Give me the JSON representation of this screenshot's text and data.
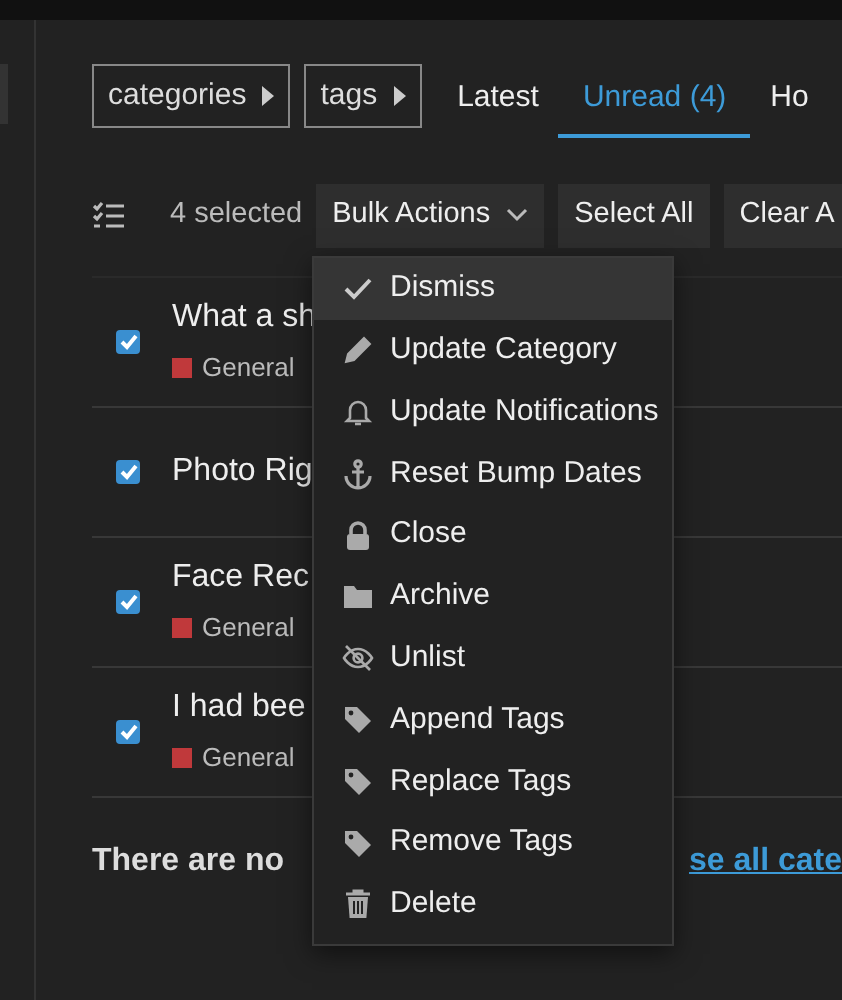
{
  "filters": [
    {
      "label": "categories"
    },
    {
      "label": "tags"
    }
  ],
  "tabs": [
    {
      "label": "Latest",
      "selected": false
    },
    {
      "label": "Unread (4)",
      "selected": true
    },
    {
      "label": "Ho",
      "selected": false
    }
  ],
  "toolbar": {
    "count": "4 selected",
    "buttons": [
      {
        "label": "Bulk Actions",
        "kind": "dropdown"
      },
      {
        "label": "Select All",
        "kind": "plain"
      },
      {
        "label": "Clear A",
        "kind": "plain"
      }
    ]
  },
  "topics": [
    {
      "title": "What a sh",
      "checked": true,
      "category": {
        "name": "General",
        "color": "#c0393b"
      }
    },
    {
      "title": "Photo Rig",
      "checked": true
    },
    {
      "title": "Face Rec",
      "checked": true,
      "category": {
        "name": "General",
        "color": "#c0393b"
      }
    },
    {
      "title": "I had bee",
      "checked": true,
      "category": {
        "name": "General",
        "color": "#c0393b"
      }
    }
  ],
  "footer": {
    "text": "There are no",
    "link": "se all cate"
  },
  "bulk_menu": [
    {
      "label": "Dismiss",
      "kind": "check",
      "selected": true
    },
    {
      "label": "Update Category",
      "kind": "pencil",
      "selected": false
    },
    {
      "label": "Update Notifications",
      "kind": "bell",
      "selected": false
    },
    {
      "label": "Reset Bump Dates",
      "kind": "anchor",
      "selected": false
    },
    {
      "label": "Close",
      "kind": "lock",
      "selected": false
    },
    {
      "label": "Archive",
      "kind": "folder",
      "selected": false
    },
    {
      "label": "Unlist",
      "kind": "unlist",
      "selected": false
    },
    {
      "label": "Append Tags",
      "kind": "tag",
      "selected": false
    },
    {
      "label": "Replace Tags",
      "kind": "tag",
      "selected": false
    },
    {
      "label": "Remove Tags",
      "kind": "tag",
      "selected": false
    },
    {
      "label": "Delete",
      "kind": "trash",
      "selected": false
    }
  ]
}
